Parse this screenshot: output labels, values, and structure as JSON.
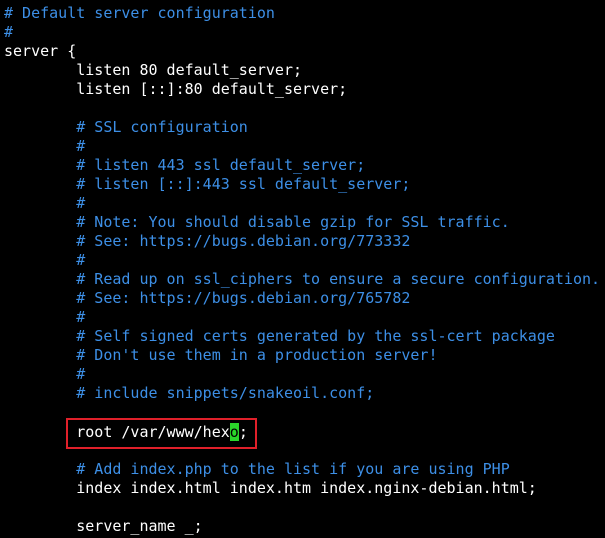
{
  "colors": {
    "background": "#000000",
    "comment": "#3d8fe6",
    "code": "#ffffff",
    "cursor": "#2bd62b",
    "highlight_box": "#e0202a"
  },
  "lines": {
    "l1": "# Default server configuration",
    "l2": "#",
    "l3": "server {",
    "l4": "        listen 80 default_server;",
    "l5": "        listen [::]:80 default_server;",
    "l7": "        # SSL configuration",
    "l8": "        #",
    "l9": "        # listen 443 ssl default_server;",
    "l10": "        # listen [::]:443 ssl default_server;",
    "l11": "        #",
    "l12": "        # Note: You should disable gzip for SSL traffic.",
    "l13": "        # See: https://bugs.debian.org/773332",
    "l14": "        #",
    "l15": "        # Read up on ssl_ciphers to ensure a secure configuration.",
    "l16": "        # See: https://bugs.debian.org/765782",
    "l17": "        #",
    "l18": "        # Self signed certs generated by the ssl-cert package",
    "l19": "        # Don't use them in a production server!",
    "l20": "        #",
    "l21": "        # include snippets/snakeoil.conf;",
    "l23_before": "        root /var/www/hex",
    "l23_cursor": "o",
    "l23_after": ";",
    "l25": "        # Add index.php to the list if you are using PHP",
    "l26": "        index index.html index.htm index.nginx-debian.html;",
    "l28": "        server_name _;"
  }
}
